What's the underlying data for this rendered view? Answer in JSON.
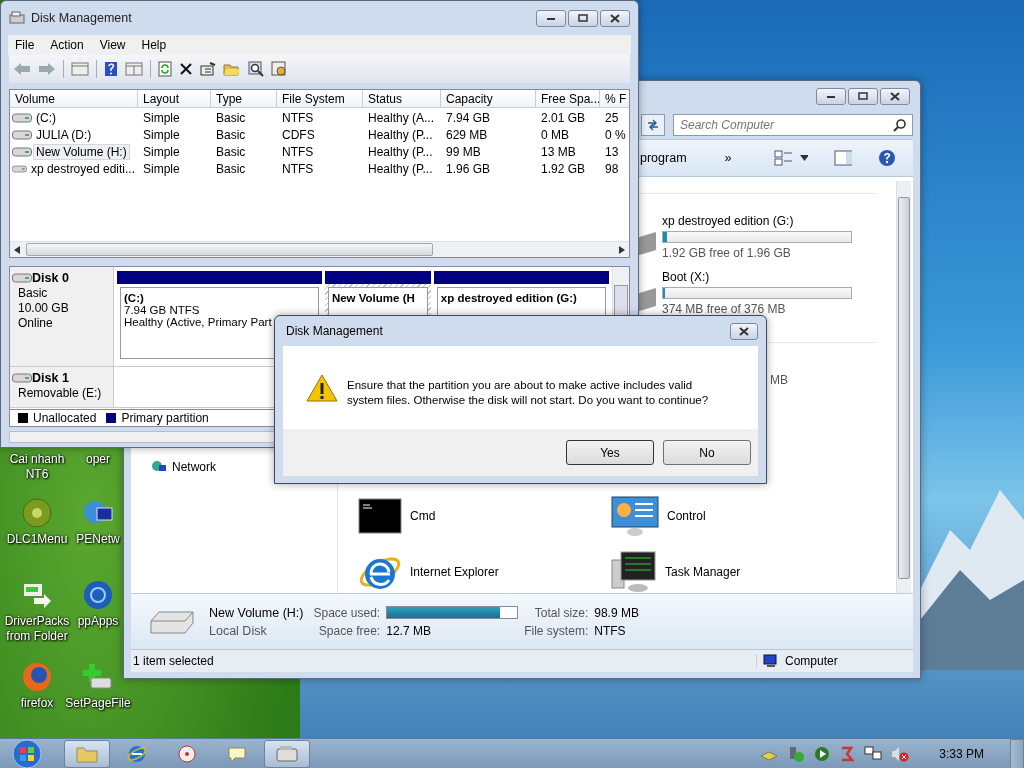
{
  "desktop_icons": [
    {
      "label": "Cai nhanh NT6",
      "kind": "hidden"
    },
    {
      "label": "oper",
      "kind": "hidden"
    },
    {
      "label": "DLC1Menu",
      "kind": "disc"
    },
    {
      "label": "PENetw",
      "kind": "network"
    },
    {
      "label": "DriverPacks from Folder",
      "kind": "transfer"
    },
    {
      "label": "ppApps",
      "kind": "globe"
    },
    {
      "label": "firefox",
      "kind": "firefox"
    },
    {
      "label": "SetPageFile",
      "kind": "pagefile"
    }
  ],
  "explorer": {
    "search": {
      "placeholder": "Search Computer"
    },
    "toolbar": [
      "program",
      "»"
    ],
    "drives": [
      {
        "name": "xp destroyed edition (G:)",
        "level": 0.02,
        "free": "1.92 GB free of 1.96 GB"
      },
      {
        "name": "Boot (X:)",
        "level": 0.01,
        "free": "374 MB free of 376 MB"
      }
    ],
    "fragment": "MB",
    "navigation": [
      {
        "label": "Network"
      }
    ],
    "programs": [
      {
        "label": "Cmd",
        "kind": "cmd"
      },
      {
        "label": "Control",
        "kind": "control"
      },
      {
        "label": "Internet Explorer",
        "kind": "browser"
      },
      {
        "label": "Task Manager",
        "kind": "monitor"
      }
    ],
    "details": {
      "name": "New Volume (H:)",
      "type": "Local Disk",
      "used_label": "Space used:",
      "level": 0.87,
      "total_label": "Total size:",
      "total": "98.9 MB",
      "free_label": "Space free:",
      "free": "12.7 MB",
      "fs_label": "File system:",
      "fs": "NTFS"
    },
    "status_bar": {
      "text": "1 item selected",
      "location": "Computer"
    }
  },
  "disk_management": {
    "title": "Disk Management",
    "menu": [
      "File",
      "Action",
      "View",
      "Help"
    ],
    "columns": [
      "Volume",
      "Layout",
      "Type",
      "File System",
      "Status",
      "Capacity",
      "Free Spa...",
      "% F"
    ],
    "rows": [
      {
        "cells": [
          "(C:)",
          "Simple",
          "Basic",
          "NTFS",
          "Healthy (A...",
          "7.94 GB",
          "2.01 GB",
          "25"
        ],
        "selected": false
      },
      {
        "cells": [
          "JULIA (D:)",
          "Simple",
          "Basic",
          "CDFS",
          "Healthy (P...",
          "629 MB",
          "0 MB",
          "0 %"
        ],
        "selected": false
      },
      {
        "cells": [
          "New Volume (H:)",
          "Simple",
          "Basic",
          "NTFS",
          "Healthy (P...",
          "99 MB",
          "13 MB",
          "13"
        ],
        "selected": true
      },
      {
        "cells": [
          "xp destroyed editi...",
          "Simple",
          "Basic",
          "NTFS",
          "Healthy (P...",
          "1.96 GB",
          "1.92 GB",
          "98"
        ],
        "selected": false
      }
    ],
    "disks": [
      {
        "name": "Disk 0",
        "details": [
          "Basic",
          "10.00 GB",
          "Online"
        ],
        "partitions": [
          {
            "name": "(C:)",
            "lines": [
              "7.94 GB NTFS",
              "Healthy (Active, Primary Part"
            ],
            "selected": false
          },
          {
            "name": "New Volume  (H",
            "selected": true
          },
          {
            "name": "xp destroyed edition  (G:)",
            "selected": false
          }
        ]
      },
      {
        "name": "Disk 1",
        "details": [
          "Removable (E:)"
        ]
      }
    ],
    "legend": [
      {
        "label": "Unallocated",
        "color": "#000000"
      },
      {
        "label": "Primary partition",
        "color": "#000080"
      }
    ]
  },
  "dialog": {
    "title": "Disk Management",
    "message": "Ensure that the partition you are about to make active includes valid system files. Otherwise the disk will not start. Do you want to continue?",
    "buttons": [
      "Yes",
      "No"
    ]
  },
  "taskbar": {
    "clock": "3:33 PM"
  }
}
